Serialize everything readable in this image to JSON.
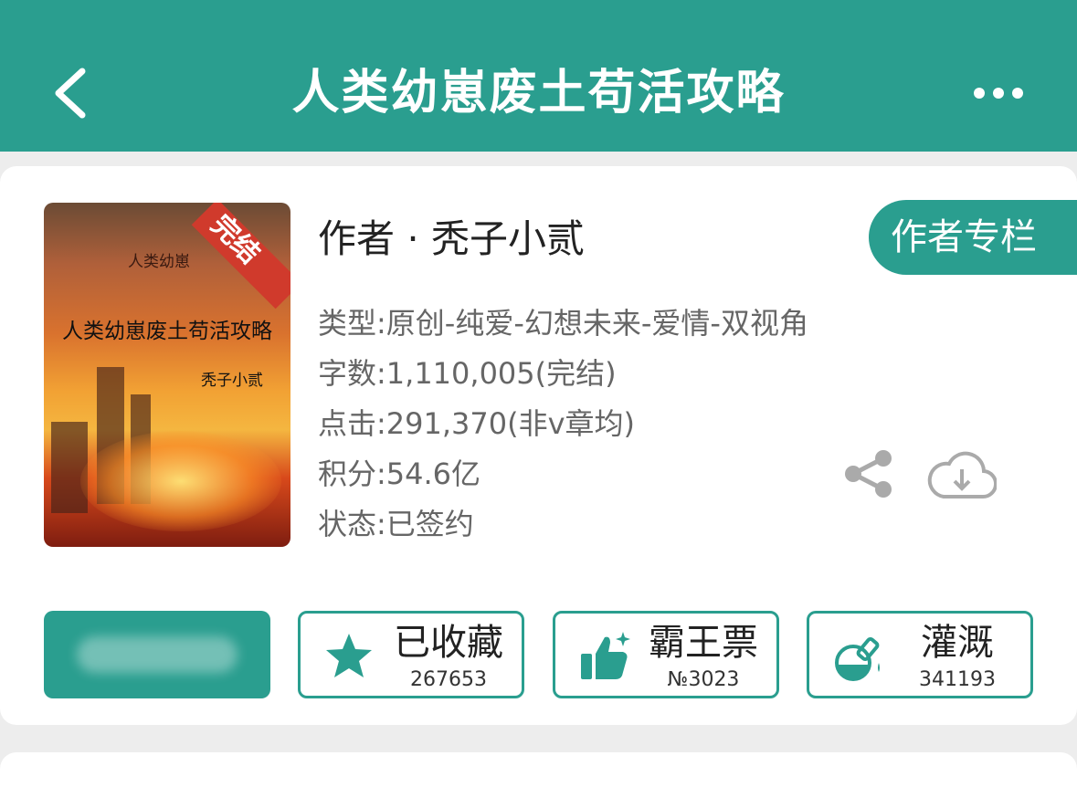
{
  "header": {
    "title": "人类幼崽废土苟活攻略",
    "back_icon": "chevron-left-icon",
    "more_icon": "more-dots-icon",
    "color": "#2a9e8f"
  },
  "book": {
    "cover": {
      "badge": "完结",
      "small_text": "人类幼崽",
      "title": "人类幼崽废土苟活攻略",
      "author": "秃子小贰"
    },
    "author_line": "作者 · 秃子小贰",
    "author_column_button": "作者专栏",
    "meta": {
      "type": "类型:原创-纯爱-幻想未来-爱情-双视角",
      "words": "字数:1,110,005(完结)",
      "clicks": "点击:291,370(非v章均)",
      "score": "积分:54.6亿",
      "status": "状态:已签约"
    },
    "share_icon": "share-icon",
    "download_icon": "cloud-download-icon"
  },
  "actions": {
    "collect": {
      "label": "已收藏",
      "count": "267653",
      "icon": "star-icon"
    },
    "vote": {
      "label": "霸王票",
      "count": "№3023",
      "icon": "thumbs-up-icon"
    },
    "water": {
      "label": "灌溉",
      "count": "341193",
      "icon": "flask-icon"
    }
  }
}
